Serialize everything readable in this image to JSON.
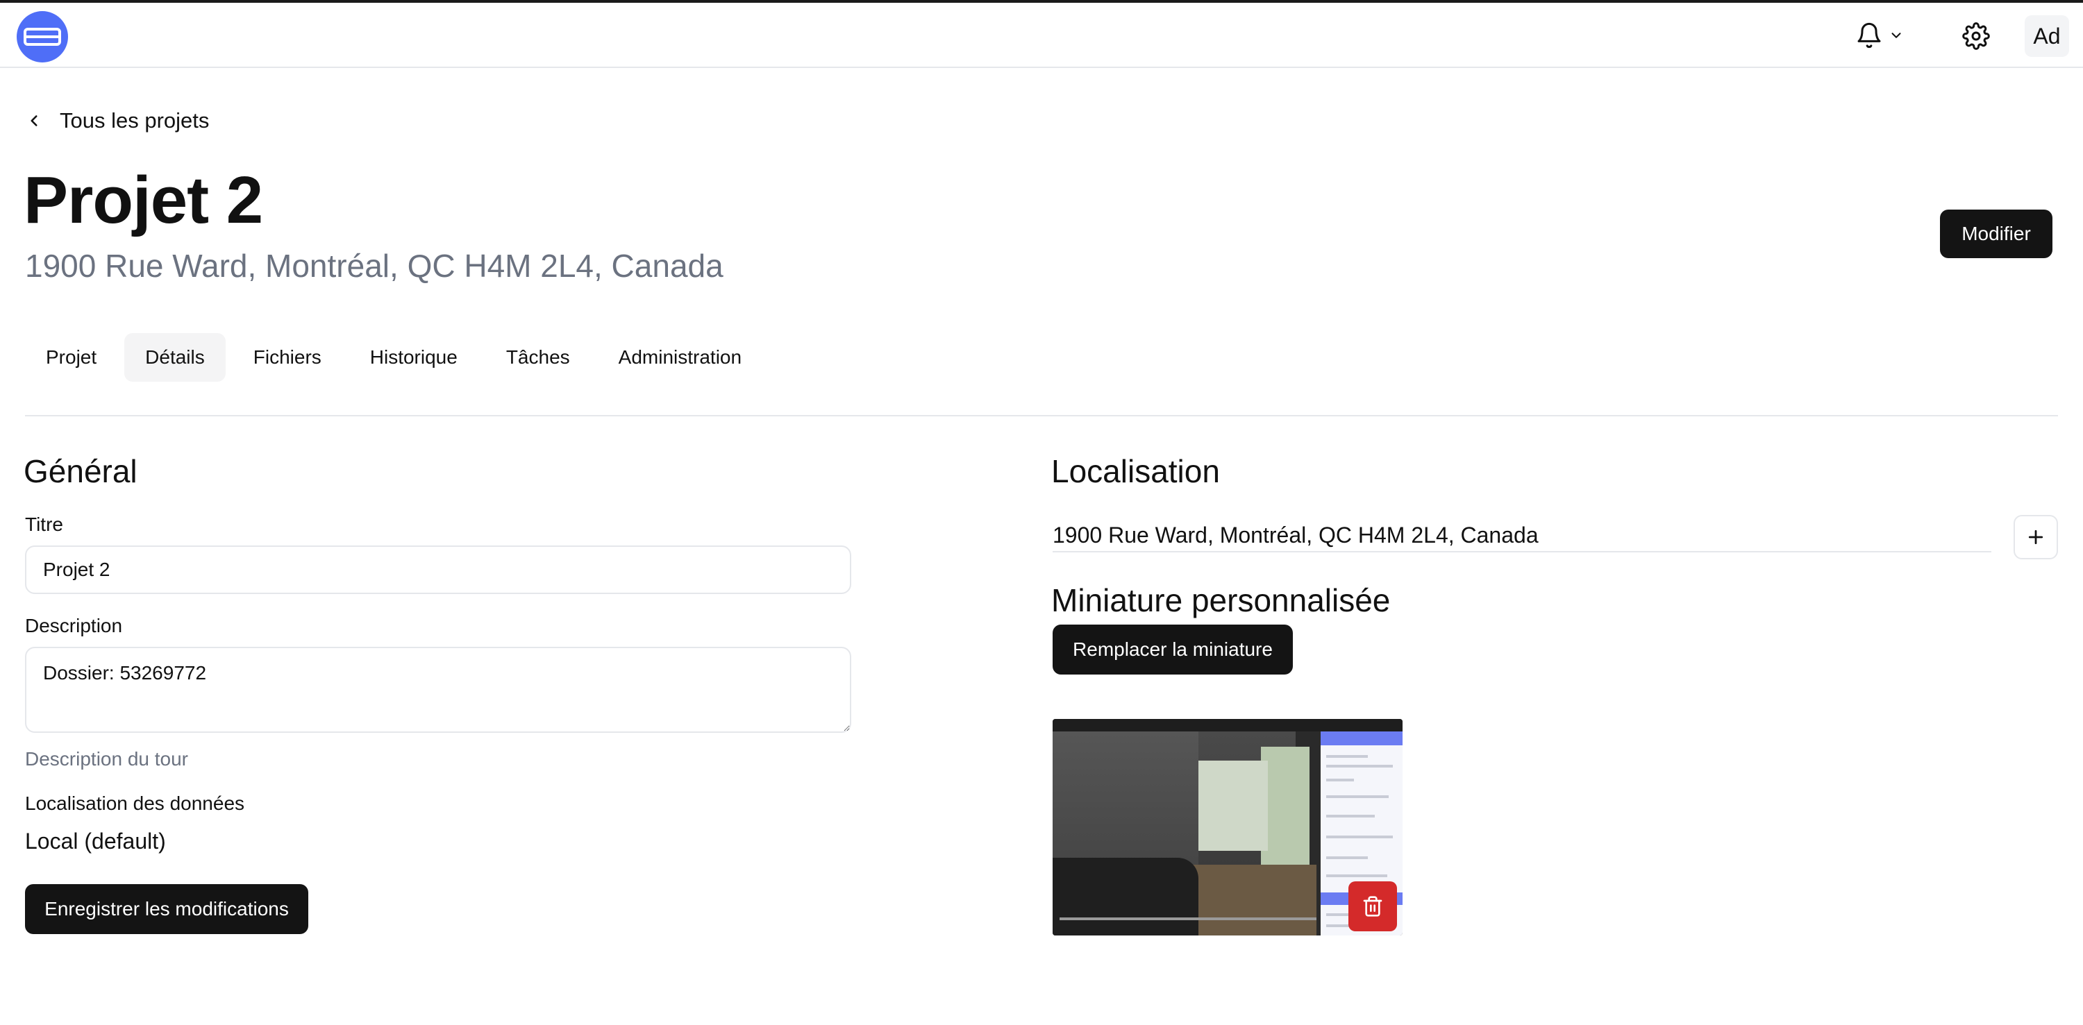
{
  "header": {
    "avatar_initials": "Ad",
    "icons": [
      "app-logo-icon",
      "bell-icon",
      "chevron-down-icon",
      "gear-icon"
    ],
    "logo_color": "#4f6ef7"
  },
  "nav": {
    "back_label": "Tous les projets"
  },
  "project": {
    "title": "Projet 2",
    "address": "1900 Rue Ward, Montréal, QC H4M 2L4, Canada",
    "modify_label": "Modifier"
  },
  "tabs": [
    {
      "label": "Projet",
      "active": false
    },
    {
      "label": "Détails",
      "active": true
    },
    {
      "label": "Fichiers",
      "active": false
    },
    {
      "label": "Historique",
      "active": false
    },
    {
      "label": "Tâches",
      "active": false
    },
    {
      "label": "Administration",
      "active": false
    }
  ],
  "general": {
    "heading": "Général",
    "title_label": "Titre",
    "title_value": "Projet 2",
    "description_label": "Description",
    "description_value": "Dossier: 53269772",
    "description_helper": "Description du tour",
    "data_location_label": "Localisation des données",
    "data_location_value": "Local (default)",
    "save_label": "Enregistrer les modifications"
  },
  "location": {
    "heading": "Localisation",
    "address": "1900 Rue Ward, Montréal, QC H4M 2L4, Canada"
  },
  "thumbnail": {
    "heading": "Miniature personnalisée",
    "replace_label": "Remplacer la miniature",
    "delete_color": "#d42a2a"
  }
}
